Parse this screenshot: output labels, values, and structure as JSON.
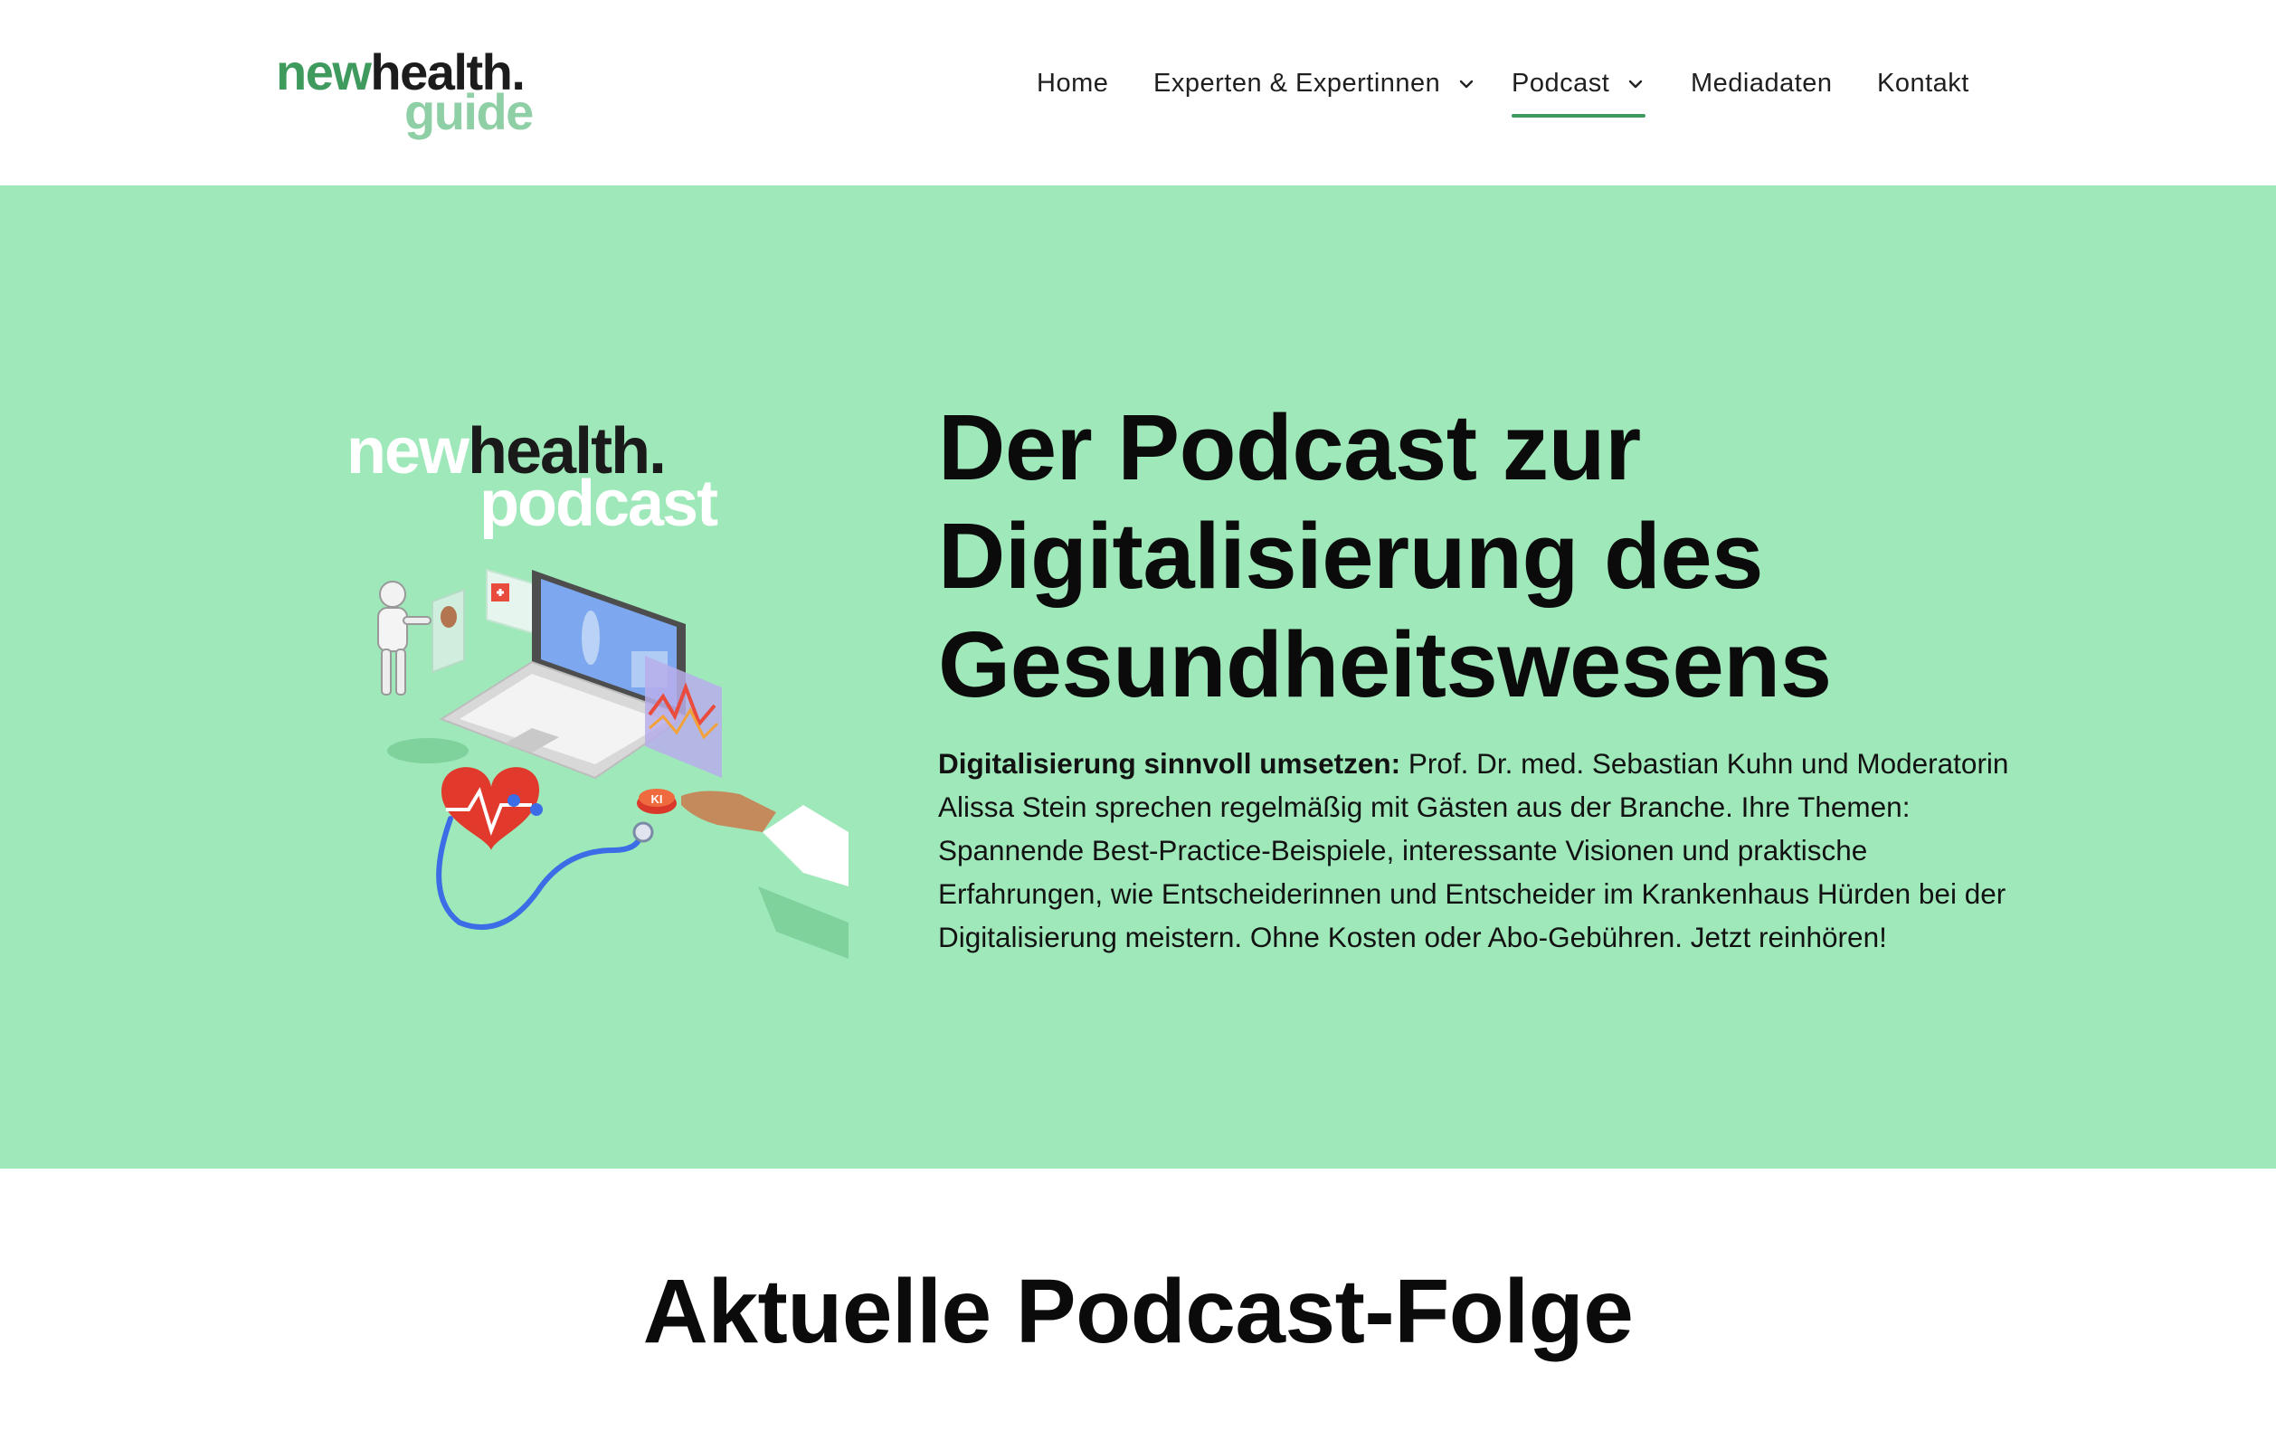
{
  "logo": {
    "new": "new",
    "health": "health.",
    "guide": "guide"
  },
  "nav": {
    "items": [
      {
        "label": "Home",
        "has_dropdown": false,
        "active": false
      },
      {
        "label": "Experten & Expertinnen",
        "has_dropdown": true,
        "active": false
      },
      {
        "label": "Podcast",
        "has_dropdown": true,
        "active": true
      },
      {
        "label": "Mediadaten",
        "has_dropdown": false,
        "active": false
      },
      {
        "label": "Kontakt",
        "has_dropdown": false,
        "active": false
      }
    ]
  },
  "hero": {
    "cover": {
      "new": "new",
      "health": "health.",
      "podcast": "podcast",
      "ki_badge": "KI"
    },
    "title_lines": [
      "Der Podcast zur",
      "Digitalisierung des",
      "Gesundheitswesens"
    ],
    "lead_bold": "Digitalisierung sinnvoll umsetzen:",
    "lead_text": " Prof. Dr. med. Sebastian Kuhn und Moderatorin Alissa Stein sprechen regelmäßig mit Gästen aus der Branche. Ihre Themen: Spannende Best-Practice-Beispiele, interessante Visionen und praktische Erfahrungen, wie Entscheiderinnen und Entscheider im Krankenhaus Hürden bei der Digitalisierung meistern. Ohne Kosten oder Abo-Gebühren. Jetzt reinhören!"
  },
  "section": {
    "title": "Aktuelle Podcast-Folge"
  },
  "colors": {
    "accent": "#3f9a5e",
    "hero_bg": "#9ee8ba",
    "logo_light": "#8fcfa5"
  }
}
